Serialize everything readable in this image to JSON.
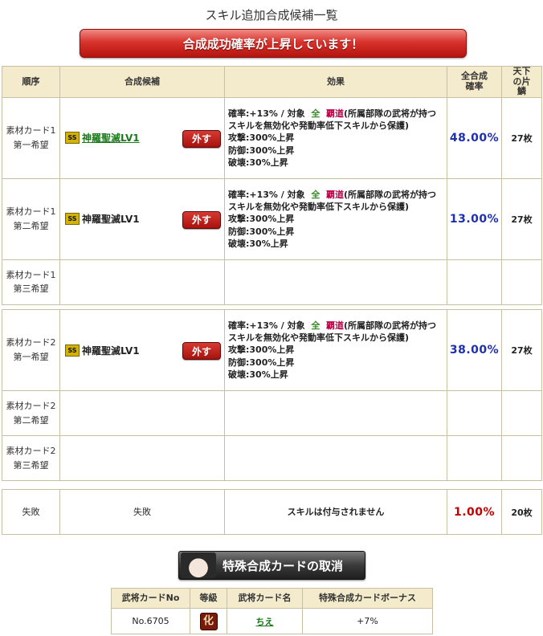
{
  "title": "スキル追加合成候補一覧",
  "banner": "合成成功確率が上昇しています！",
  "headers": {
    "order": "順序",
    "candidate": "合成候補",
    "effect": "効果",
    "rate": "全合成確率",
    "pieces": "天下の片鱗"
  },
  "remove_label": "外す",
  "ss_badge": "SS",
  "group1": [
    {
      "order_line1": "素材カード1",
      "order_line2": "第一希望",
      "skill": "神羅聖滅LV1",
      "effect": {
        "rate": "確率:+13%",
        "sep": " / ",
        "target_label": "対象",
        "target_all": "全",
        "target_class": "覇道",
        "desc": "(所属部隊の武将が持つスキルを無効化や発動率低下スキルから保護)",
        "atk": "攻撃:300%上昇",
        "def": "防御:300%上昇",
        "brk": "破壊:30%上昇"
      },
      "rate": "48.00%",
      "pieces": "27枚"
    },
    {
      "order_line1": "素材カード1",
      "order_line2": "第二希望",
      "skill": "神羅聖滅LV1",
      "effect": {
        "rate": "確率:+13%",
        "sep": " / ",
        "target_label": "対象",
        "target_all": "全",
        "target_class": "覇道",
        "desc": "(所属部隊の武将が持つスキルを無効化や発動率低下スキルから保護)",
        "atk": "攻撃:300%上昇",
        "def": "防御:300%上昇",
        "brk": "破壊:30%上昇"
      },
      "rate": "13.00%",
      "pieces": "27枚"
    },
    {
      "order_line1": "素材カード1",
      "order_line2": "第三希望"
    }
  ],
  "group2": [
    {
      "order_line1": "素材カード2",
      "order_line2": "第一希望",
      "skill": "神羅聖滅LV1",
      "effect": {
        "rate": "確率:+13%",
        "sep": " / ",
        "target_label": "対象",
        "target_all": "全",
        "target_class": "覇道",
        "desc": "(所属部隊の武将が持つスキルを無効化や発動率低下スキルから保護)",
        "atk": "攻撃:300%上昇",
        "def": "防御:300%上昇",
        "brk": "破壊:30%上昇"
      },
      "rate": "38.00%",
      "pieces": "27枚"
    },
    {
      "order_line1": "素材カード2",
      "order_line2": "第二希望"
    },
    {
      "order_line1": "素材カード2",
      "order_line2": "第三希望"
    }
  ],
  "failure": {
    "order": "失敗",
    "candidate": "失敗",
    "effect": "スキルは付与されません",
    "rate": "1.00%",
    "pieces": "20枚"
  },
  "cancel_button": "特殊合成カードの取消",
  "bonus_table": {
    "headers": [
      "武将カードNo",
      "等級",
      "武将カード名",
      "特殊合成カードボーナス"
    ],
    "row": {
      "no": "No.6705",
      "grade": "化",
      "name": "ちえ",
      "bonus": "+7%"
    }
  },
  "colors": {
    "header_bg": "#f4ebcc",
    "border": "#c8bfa4",
    "rate_blue": "#1e2fb0",
    "rate_red": "#c40000",
    "banner_red": "#d8332c"
  }
}
